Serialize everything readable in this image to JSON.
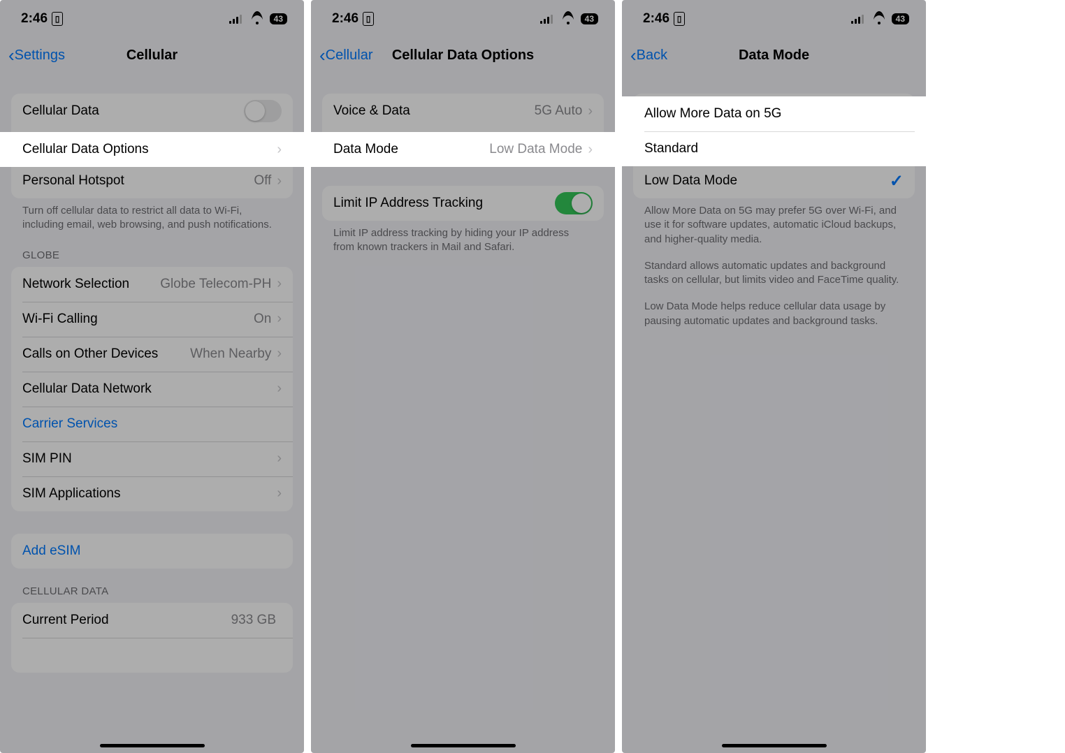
{
  "status": {
    "time": "2:46",
    "battery": "43"
  },
  "screen1": {
    "back": "Settings",
    "title": "Cellular",
    "rows": {
      "cellular_data": "Cellular Data",
      "cellular_data_options": "Cellular Data Options",
      "personal_hotspot": "Personal Hotspot",
      "personal_hotspot_value": "Off",
      "footer1": "Turn off cellular data to restrict all data to Wi-Fi, including email, web browsing, and push notifications.",
      "header_globe": "GLOBE",
      "network_selection": "Network Selection",
      "network_selection_value": "Globe Telecom-PH",
      "wifi_calling": "Wi-Fi Calling",
      "wifi_calling_value": "On",
      "calls_other": "Calls on Other Devices",
      "calls_other_value": "When Nearby",
      "cdn": "Cellular Data Network",
      "carrier_services": "Carrier Services",
      "sim_pin": "SIM PIN",
      "sim_apps": "SIM Applications",
      "add_esim": "Add eSIM",
      "header_cdata": "CELLULAR DATA",
      "current_period": "Current Period",
      "current_period_value": "933 GB"
    }
  },
  "screen2": {
    "back": "Cellular",
    "title": "Cellular Data Options",
    "rows": {
      "voice_data": "Voice & Data",
      "voice_data_value": "5G Auto",
      "data_mode": "Data Mode",
      "data_mode_value": "Low Data Mode",
      "limit_ip": "Limit IP Address Tracking",
      "limit_ip_footer": "Limit IP address tracking by hiding your IP address from known trackers in Mail and Safari."
    }
  },
  "screen3": {
    "back": "Back",
    "title": "Data Mode",
    "rows": {
      "allow_more": "Allow More Data on 5G",
      "standard": "Standard",
      "low_data": "Low Data Mode",
      "footer_p1": "Allow More Data on 5G may prefer 5G over Wi-Fi, and use it for software updates, automatic iCloud backups, and higher-quality media.",
      "footer_p2": "Standard allows automatic updates and background tasks on cellular, but limits video and FaceTime quality.",
      "footer_p3": "Low Data Mode helps reduce cellular data usage by pausing automatic updates and background tasks."
    }
  }
}
